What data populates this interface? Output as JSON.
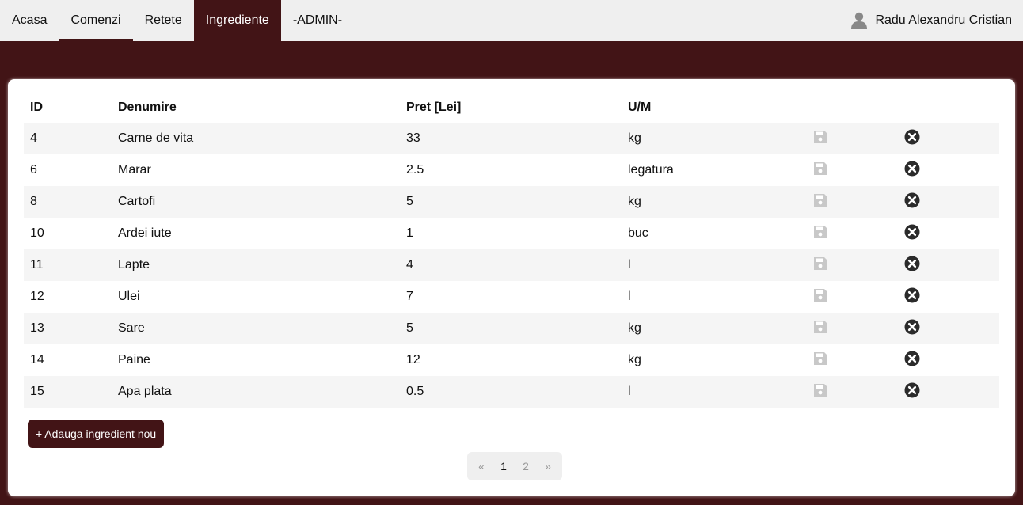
{
  "nav": {
    "items": [
      {
        "label": "Acasa"
      },
      {
        "label": "Comenzi"
      },
      {
        "label": "Retete"
      },
      {
        "label": "Ingrediente"
      },
      {
        "label": "-ADMIN-"
      }
    ],
    "active_index": 3,
    "user_name": "Radu Alexandru Cristian",
    "user_icon": "user-icon"
  },
  "table": {
    "headers": [
      "ID",
      "Denumire",
      "Pret [Lei]",
      "U/M",
      "",
      ""
    ],
    "rows": [
      {
        "id": "4",
        "name": "Carne de vita",
        "price": "33",
        "um": "kg"
      },
      {
        "id": "6",
        "name": "Marar",
        "price": "2.5",
        "um": "legatura"
      },
      {
        "id": "8",
        "name": "Cartofi",
        "price": "5",
        "um": "kg"
      },
      {
        "id": "10",
        "name": "Ardei iute",
        "price": "1",
        "um": "buc"
      },
      {
        "id": "11",
        "name": "Lapte",
        "price": "4",
        "um": "l"
      },
      {
        "id": "12",
        "name": "Ulei",
        "price": "7",
        "um": "l"
      },
      {
        "id": "13",
        "name": "Sare",
        "price": "5",
        "um": "kg"
      },
      {
        "id": "14",
        "name": "Paine",
        "price": "12",
        "um": "kg"
      },
      {
        "id": "15",
        "name": "Apa plata",
        "price": "0.5",
        "um": "l"
      }
    ],
    "row_icons": {
      "save": "save-icon",
      "delete": "delete-circle-icon"
    }
  },
  "add_button_label": "+ Adauga ingredient nou",
  "pagination": {
    "prev": "«",
    "pages": [
      "1",
      "2"
    ],
    "current": "1",
    "next": "»"
  },
  "colors": {
    "accent": "#421416",
    "nav_bg": "#efefef",
    "stripe": "#f5f5f5",
    "save_icon": "#c8c8c8",
    "delete_icon": "#2b2b2b"
  }
}
